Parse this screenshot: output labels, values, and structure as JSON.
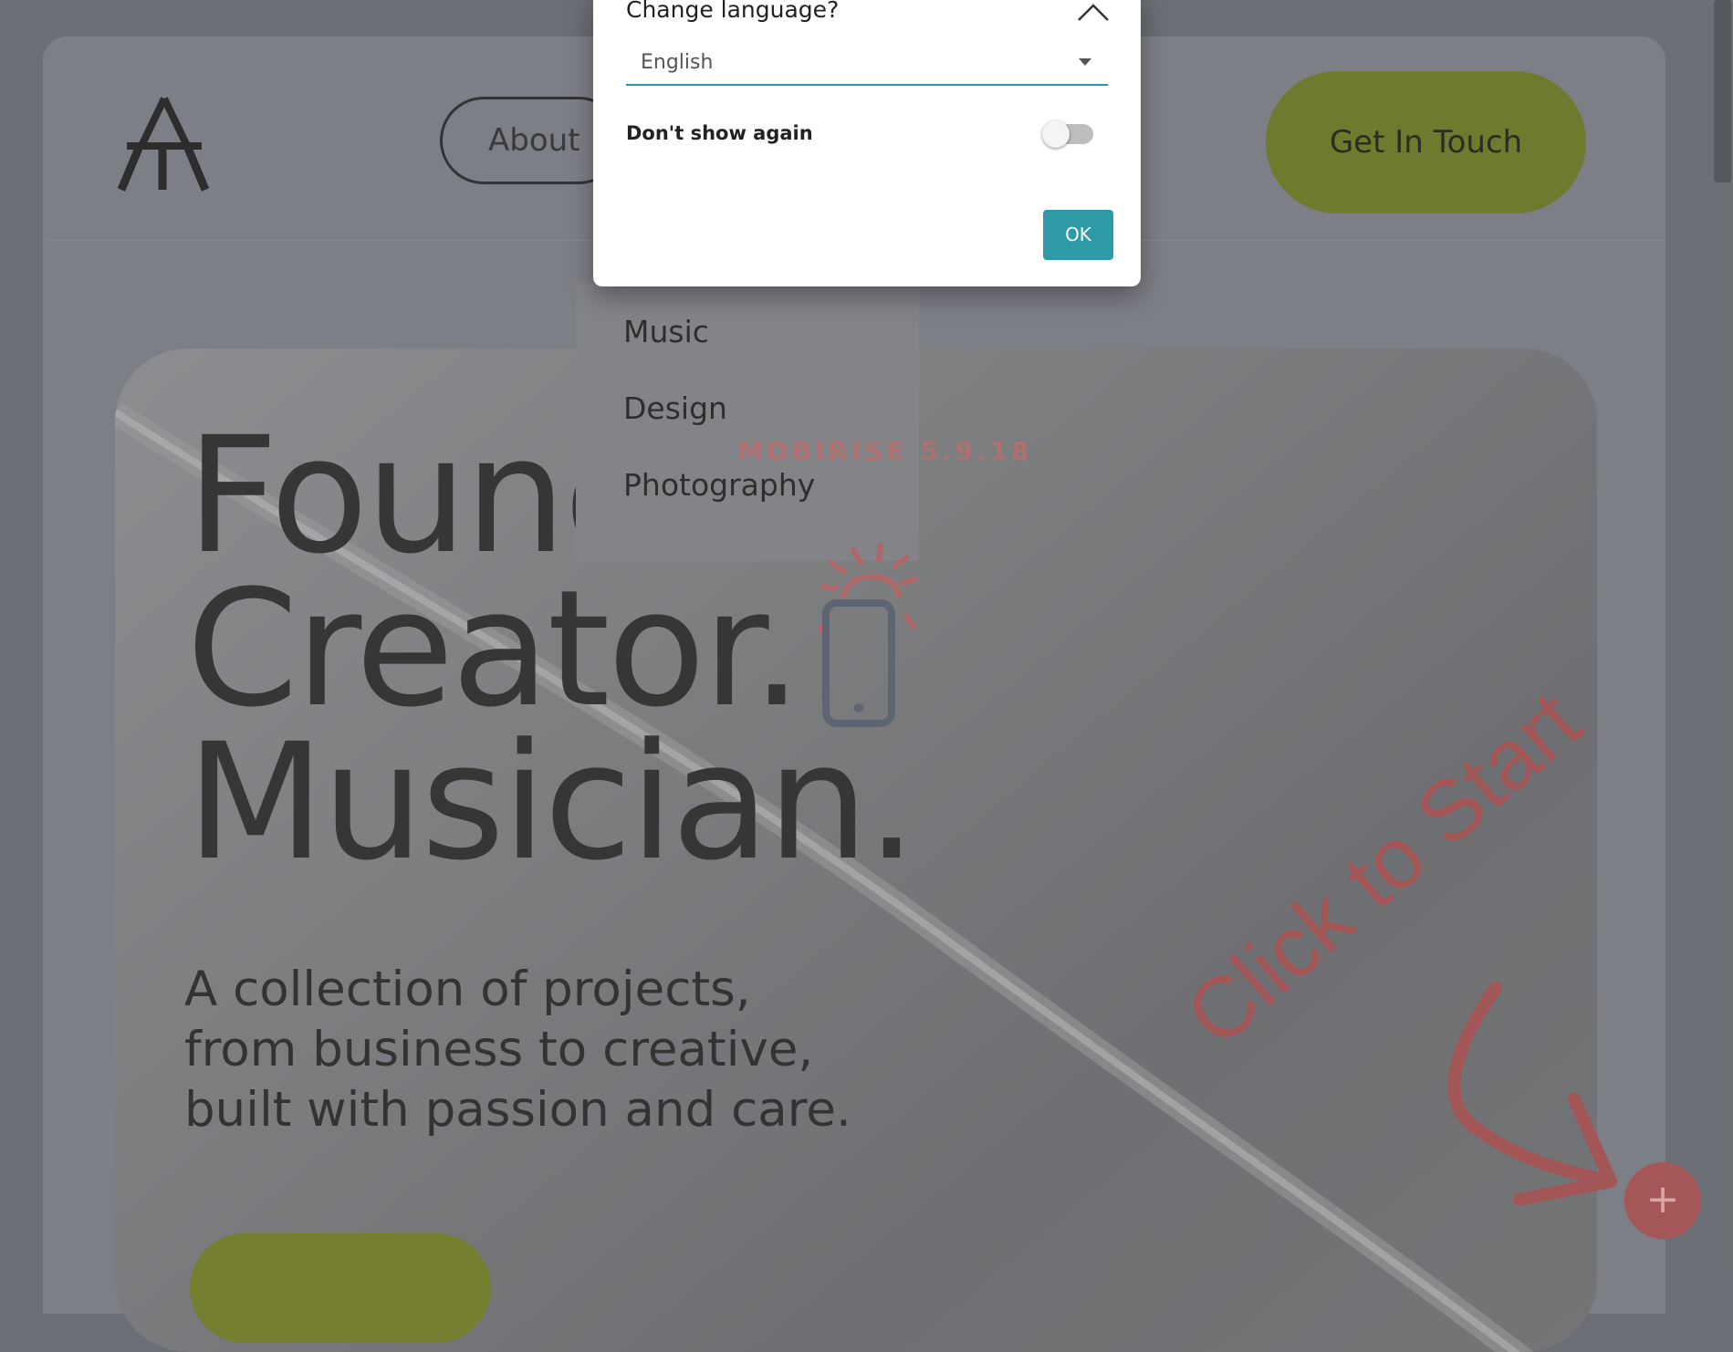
{
  "header": {
    "about_label": "About",
    "cta_label": "Get In Touch"
  },
  "hero": {
    "title_lines": [
      "Founder.",
      "Creator.",
      "Musician."
    ],
    "subtitle_lines": [
      "A collection of projects,",
      "from business to creative,",
      "built with passion and care."
    ]
  },
  "dropdown": {
    "items": [
      "Music",
      "Design",
      "Photography"
    ]
  },
  "builder": {
    "watermark": "MOBIRISE  5.9.18",
    "click_hint": "Click to Start",
    "fab_symbol": "+"
  },
  "modal": {
    "title": "Change language?",
    "select_value": "English",
    "dont_show_label": "Don't show again",
    "dont_show_checked": false,
    "ok_label": "OK"
  },
  "colors": {
    "accent_green": "#707a2f",
    "modal_accent": "#2e9aa7",
    "hint_red": "#a25656"
  }
}
